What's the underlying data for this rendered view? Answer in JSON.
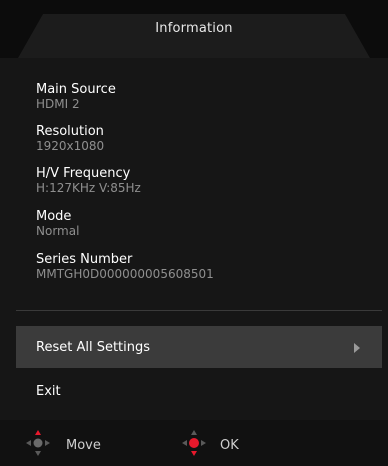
{
  "header": {
    "title": "Information"
  },
  "info": {
    "fields": [
      {
        "label": "Main Source",
        "value": "HDMI 2"
      },
      {
        "label": "Resolution",
        "value": "1920x1080"
      },
      {
        "label": "H/V Frequency",
        "value": "H:127KHz  V:85Hz"
      },
      {
        "label": "Mode",
        "value": "Normal"
      },
      {
        "label": "Series Number",
        "value": "MMTGH0D000000005608501"
      }
    ]
  },
  "menu": {
    "items": [
      {
        "label": "Reset All Settings",
        "selected": true
      },
      {
        "label": "Exit",
        "selected": false
      }
    ]
  },
  "footer": {
    "move_label": "Move",
    "ok_label": "OK",
    "move_icon": "dpad-move-icon",
    "ok_icon": "dpad-ok-icon"
  },
  "colors": {
    "background": "#161616",
    "header": "#0c0c0c",
    "selected_row": "#3b3b3b",
    "value_text": "#8f8f8f",
    "accent_red": "#e8192c"
  }
}
